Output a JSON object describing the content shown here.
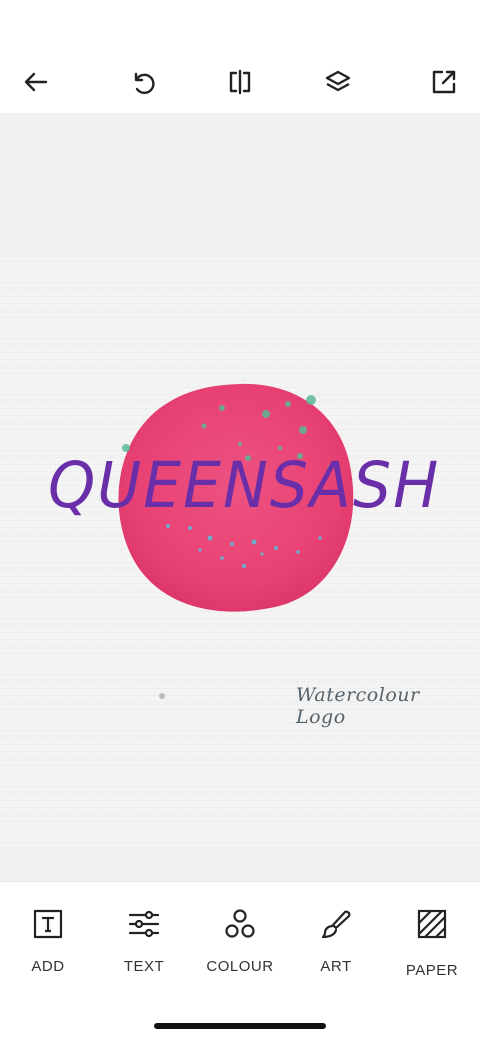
{
  "toolbar_top": {
    "items": [
      {
        "icon": "back-arrow-icon"
      },
      {
        "icon": "undo-icon"
      },
      {
        "icon": "flip-icon"
      },
      {
        "icon": "layers-icon"
      },
      {
        "icon": "share-export-icon"
      }
    ]
  },
  "canvas": {
    "title": "QUEENSASH",
    "subtitle": "Watercolour Logo",
    "title_color": "#6a2ea8",
    "blot_color": "#e8386d",
    "splatter_colors": [
      "#5bb89a",
      "#5fb8d6"
    ]
  },
  "toolbar_bottom": {
    "tools": [
      {
        "label": "ADD",
        "icon": "add-text-box-icon"
      },
      {
        "label": "TEXT",
        "icon": "sliders-icon"
      },
      {
        "label": "COLOUR",
        "icon": "circles-icon"
      },
      {
        "label": "ART",
        "icon": "brush-icon"
      },
      {
        "label": "PAPER",
        "icon": "paper-hatch-icon"
      }
    ]
  }
}
